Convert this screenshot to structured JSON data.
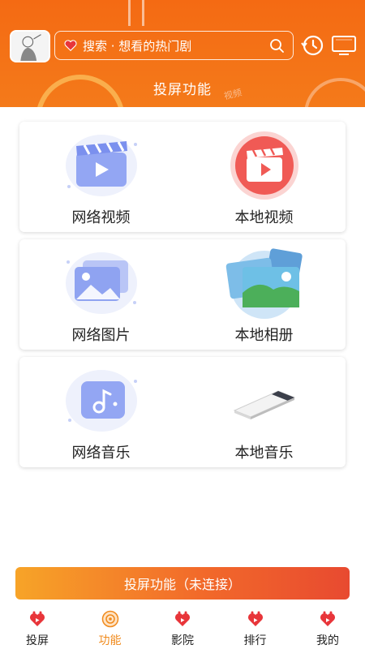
{
  "header": {
    "search_placeholder": "搜索 · 想看的热门剧",
    "title": "投屏功能",
    "deco_text": "视频"
  },
  "cards": [
    {
      "items": [
        {
          "label": "网络视频",
          "icon": "network-video-icon"
        },
        {
          "label": "本地视频",
          "icon": "local-video-icon"
        }
      ]
    },
    {
      "items": [
        {
          "label": "网络图片",
          "icon": "network-image-icon"
        },
        {
          "label": "本地相册",
          "icon": "local-album-icon"
        }
      ]
    },
    {
      "items": [
        {
          "label": "网络音乐",
          "icon": "network-music-icon"
        },
        {
          "label": "本地音乐",
          "icon": "local-music-icon"
        }
      ]
    }
  ],
  "cta": {
    "label": "投屏功能（未连接）"
  },
  "nav": {
    "items": [
      {
        "label": "投屏",
        "icon": "cast-icon",
        "active": false
      },
      {
        "label": "功能",
        "icon": "function-icon",
        "active": true
      },
      {
        "label": "影院",
        "icon": "cinema-icon",
        "active": false
      },
      {
        "label": "排行",
        "icon": "ranking-icon",
        "active": false
      },
      {
        "label": "我的",
        "icon": "profile-icon",
        "active": false
      }
    ]
  },
  "colors": {
    "header": "#f46a13",
    "accent": "#f08a1c",
    "cta_start": "#f7a428",
    "cta_end": "#e84a30"
  }
}
